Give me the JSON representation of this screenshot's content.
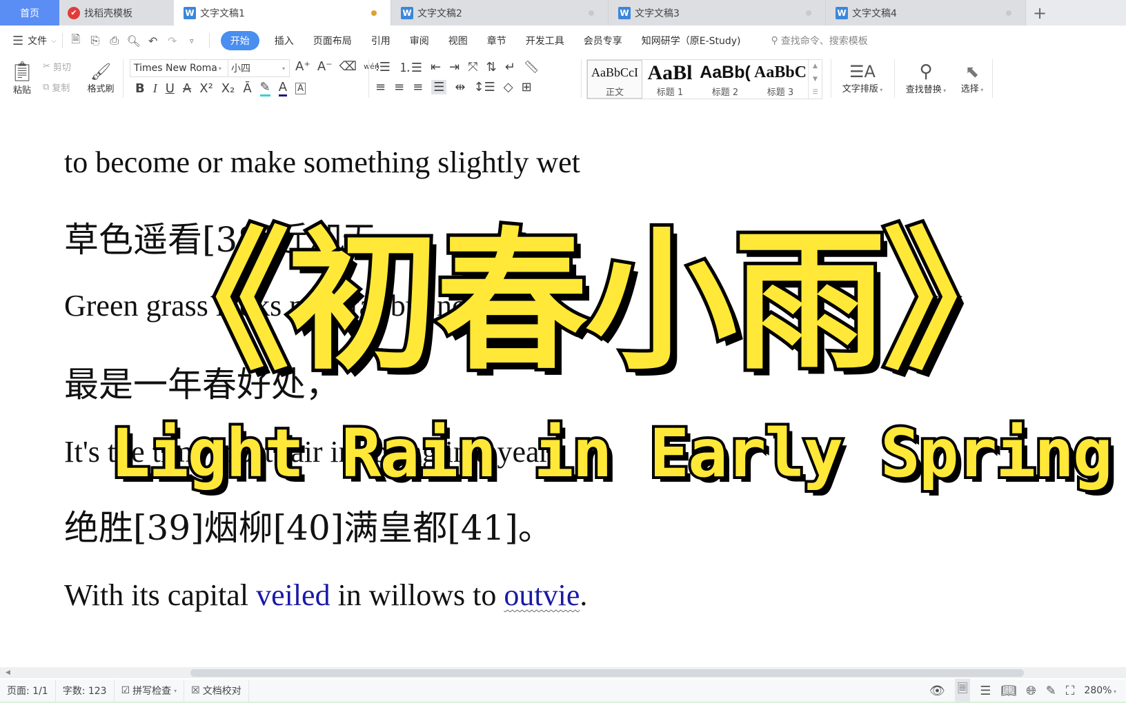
{
  "tabs": [
    {
      "label": "首页",
      "type": "home"
    },
    {
      "label": "找稻壳模板",
      "type": "templates"
    },
    {
      "label": "文字文稿1",
      "type": "doc",
      "active": true
    },
    {
      "label": "文字文稿2",
      "type": "doc"
    },
    {
      "label": "文字文稿3",
      "type": "doc"
    },
    {
      "label": "文字文稿4",
      "type": "doc"
    }
  ],
  "menu": {
    "file_label": "文件",
    "tabs": [
      "开始",
      "插入",
      "页面布局",
      "引用",
      "审阅",
      "视图",
      "章节",
      "开发工具",
      "会员专享",
      "知网研学（原E-Study)"
    ],
    "active_tab": "开始",
    "search_placeholder": "查找命令、搜索模板"
  },
  "ribbon": {
    "paste": "粘贴",
    "cut": "剪切",
    "copy": "复制",
    "format_painter": "格式刷",
    "font_name": "Times New Roma",
    "font_size": "小四",
    "pinyin_glyph": "wén",
    "styles": [
      {
        "preview": "AaBbCcI",
        "label": "正文",
        "selected": true
      },
      {
        "preview": "AaBl",
        "label": "标题 1"
      },
      {
        "preview": "AaBb(",
        "label": "标题 2"
      },
      {
        "preview": "AaBbC",
        "label": "标题 3"
      }
    ],
    "text_layout": "文字排版",
    "find_replace": "查找替换",
    "select": "选择"
  },
  "document": {
    "lines": [
      {
        "text": "to become or make something slightly wet",
        "lang": "en"
      },
      {
        "text": "草色遥看[38]近却无。",
        "lang": "zh"
      },
      {
        "text": "Green grass looks near far but not near",
        "lang": "en"
      },
      {
        "text": "最是一年春好处，",
        "lang": "zh"
      },
      {
        "text": "It's the time most fair in spring in a year",
        "lang": "en"
      },
      {
        "text": "绝胜[39]烟柳[40]满皇都[41]。",
        "lang": "zh"
      }
    ],
    "last_line": {
      "part1": "With its capital ",
      "link1": "veiled",
      "part2": " in willows to ",
      "link2": "outvie",
      "part3": "."
    }
  },
  "overlay": {
    "title": "《初春小雨》",
    "subtitle": "Light Rain in Early Spring",
    "fill_color": "#ffe838",
    "stroke_color": "#000000"
  },
  "status": {
    "page": "页面: 1/1",
    "word_count": "字数: 123",
    "spell_check": "拼写检查",
    "doc_proof": "文档校对",
    "zoom": "280%"
  }
}
